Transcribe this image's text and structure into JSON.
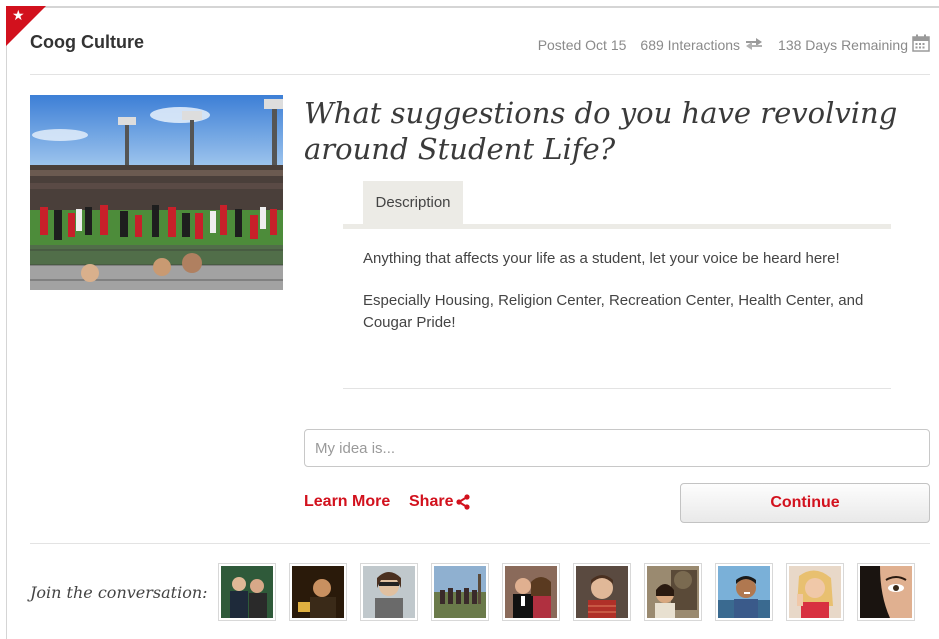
{
  "brand": "Coog Culture",
  "meta": {
    "posted": "Posted Oct 15",
    "interactions": "689 Interactions",
    "remaining": "138 Days Remaining"
  },
  "question": "What suggestions do you have revolving around Student Life?",
  "tabs": {
    "description": "Description"
  },
  "description": {
    "p1": "Anything that affects your life as a student, let your voice be heard here!",
    "p2": "Especially Housing, Religion Center, Recreation Center, Health Center, and Cougar Pride!"
  },
  "idea_input": {
    "placeholder": "My idea is...",
    "value": ""
  },
  "actions": {
    "learn_more": "Learn More",
    "share": "Share",
    "continue": "Continue"
  },
  "join_label": "Join the conversation:",
  "icons": {
    "corner": "star-icon",
    "interactions": "swap-arrows-icon",
    "remaining": "calendar-icon",
    "share": "share-icon"
  },
  "colors": {
    "accent": "#d2111d",
    "tab_bg": "#ecebe6",
    "meta_text": "#8a8a8a"
  }
}
